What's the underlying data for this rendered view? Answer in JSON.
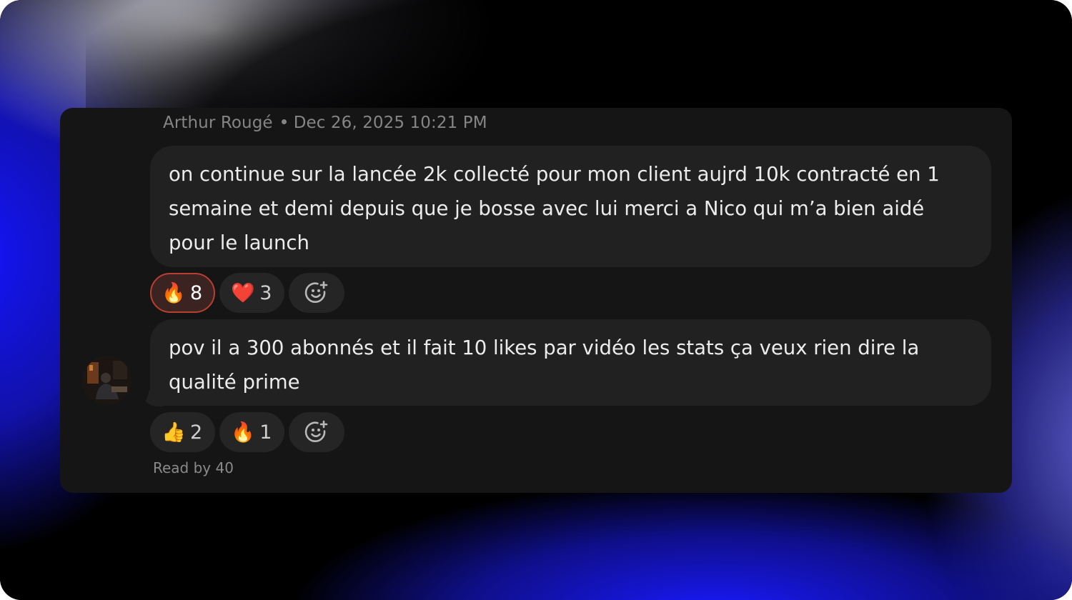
{
  "message_meta": {
    "author": "Arthur Rougé",
    "timestamp": "Dec 26, 2025 10:21 PM"
  },
  "messages": [
    {
      "text": "on continue sur la lancée 2k collecté pour mon client aujrd 10k contracté en 1 semaine et demi depuis que je bosse avec lui merci a Nico qui m’a bien aidé pour le launch",
      "reactions": [
        {
          "emoji": "🔥",
          "icon": "fire-icon",
          "count": "8",
          "active": true
        },
        {
          "emoji": "❤️",
          "icon": "red-heart-icon",
          "count": "3",
          "active": false
        }
      ]
    },
    {
      "text": "pov il a 300 abonnés et il fait 10 likes par vidéo les stats ça veux rien dire la qualité prime",
      "reactions": [
        {
          "emoji": "👍",
          "icon": "thumbs-up-icon",
          "count": "2",
          "active": false
        },
        {
          "emoji": "🔥",
          "icon": "fire-icon",
          "count": "1",
          "active": false
        }
      ]
    }
  ],
  "read_receipt": "Read by 40",
  "colors": {
    "card_bg": "#151515",
    "bubble_bg": "#212121",
    "active_reaction_border": "#b7402e",
    "meta_text": "#858585"
  }
}
